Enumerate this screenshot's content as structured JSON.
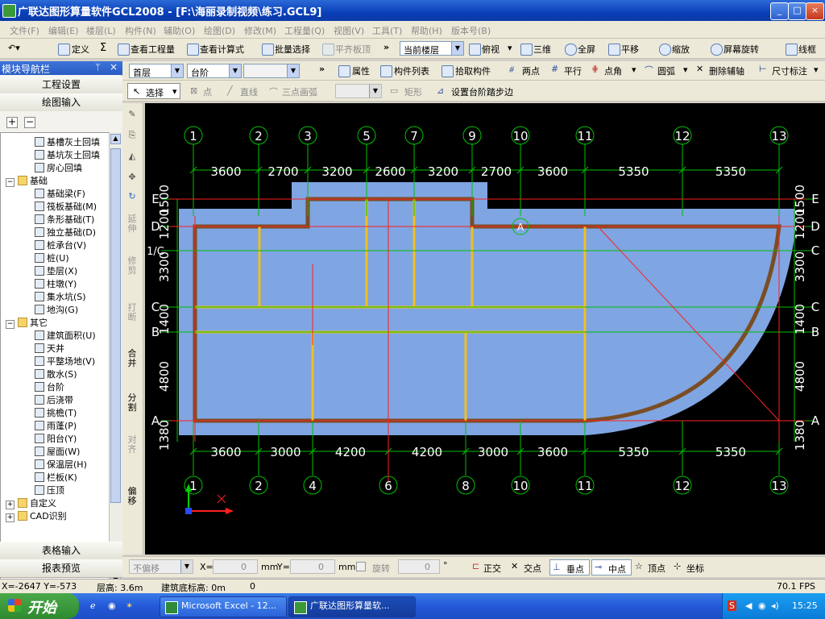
{
  "window": {
    "title": "广联达图形算量软件GCL2008 - [F:\\海丽录制视频\\练习.GCL9]",
    "btn_min": "_",
    "btn_max": "□",
    "btn_close": "×"
  },
  "menu": [
    "文件(F)",
    "编辑(E)",
    "楼层(L)",
    "构件(N)",
    "辅助(O)",
    "绘图(D)",
    "修改(M)",
    "工程量(Q)",
    "视图(V)",
    "工具(T)",
    "帮助(H)",
    "版本号(B)"
  ],
  "toolbar1": {
    "define": "定义",
    "sum": "Σ",
    "summary": "汇总计算",
    "view_project": "查看工程量",
    "view_formula": "查看计算式",
    "batch_select": "批量选择",
    "align_slab": "平齐板顶",
    "floor_combo": "当前楼层",
    "plan_view": "俯视",
    "three_d": "三维",
    "fullscreen": "全屏",
    "pan": "平移",
    "zoom": "缩放",
    "rotate": "屏幕旋转",
    "wireframe": "线框"
  },
  "toolbar2": {
    "floor": "首层",
    "component_type": "台阶",
    "properties": "属性",
    "comp_list": "构件列表",
    "pick": "拾取构件",
    "two_point": "两点",
    "parallel": "平行",
    "point_angle": "点角",
    "circle": "圆弧",
    "delete_aux": "删除辅轴",
    "dimension": "尺寸标注"
  },
  "toolbar3": {
    "select": "选择",
    "point": "点",
    "line": "直线",
    "arc3": "三点画弧",
    "rect": "矩形",
    "set_step": "设置台阶踏步边"
  },
  "left_panel": {
    "header": "模块导航栏",
    "pin": "ᛘ",
    "close": "×",
    "project_settings": "工程设置",
    "drawing_input": "绘图输入",
    "table_input": "表格输入",
    "report_preview": "报表预览",
    "tree": [
      {
        "label": "基槽灰土回填",
        "level": 2
      },
      {
        "label": "基坑灰土回填",
        "level": 2
      },
      {
        "label": "房心回填",
        "level": 2
      },
      {
        "label": "基础",
        "level": 1,
        "folder": true
      },
      {
        "label": "基础梁(F)",
        "level": 2
      },
      {
        "label": "筏板基础(M)",
        "level": 2
      },
      {
        "label": "条形基础(T)",
        "level": 2
      },
      {
        "label": "独立基础(D)",
        "level": 2
      },
      {
        "label": "桩承台(V)",
        "level": 2
      },
      {
        "label": "桩(U)",
        "level": 2
      },
      {
        "label": "垫层(X)",
        "level": 2
      },
      {
        "label": "柱墩(Y)",
        "level": 2
      },
      {
        "label": "集水坑(S)",
        "level": 2
      },
      {
        "label": "地沟(G)",
        "level": 2
      },
      {
        "label": "其它",
        "level": 1,
        "folder": true
      },
      {
        "label": "建筑面积(U)",
        "level": 2
      },
      {
        "label": "天井",
        "level": 2
      },
      {
        "label": "平整场地(V)",
        "level": 2
      },
      {
        "label": "散水(S)",
        "level": 2
      },
      {
        "label": "台阶",
        "level": 2
      },
      {
        "label": "后浇带",
        "level": 2
      },
      {
        "label": "挑檐(T)",
        "level": 2
      },
      {
        "label": "雨蓬(P)",
        "level": 2
      },
      {
        "label": "阳台(Y)",
        "level": 2
      },
      {
        "label": "屋面(W)",
        "level": 2
      },
      {
        "label": "保温层(H)",
        "level": 2
      },
      {
        "label": "栏板(K)",
        "level": 2
      },
      {
        "label": "压顶",
        "level": 2
      },
      {
        "label": "自定义",
        "level": 1,
        "folder": true
      },
      {
        "label": "CAD识别",
        "level": 1,
        "folder": true
      }
    ]
  },
  "vertical_toolbar": [
    "延伸",
    "修剪",
    "打断",
    "合并",
    "分割",
    "对齐",
    "偏移"
  ],
  "drawing": {
    "top_axes": [
      "1",
      "2",
      "3",
      "5",
      "7",
      "9",
      "10",
      "11",
      "12",
      "13"
    ],
    "top_dims": [
      "3600",
      "2700",
      "3200",
      "2600",
      "3200",
      "2700",
      "3600",
      "5350",
      "5350"
    ],
    "bottom_axes": [
      "1",
      "2",
      "4",
      "6",
      "8",
      "10",
      "11",
      "12",
      "13"
    ],
    "bottom_dims": [
      "3600",
      "3000",
      "4200",
      "4200",
      "3000",
      "3600",
      "5350",
      "5350"
    ],
    "left_axes": [
      "E",
      "D",
      "1/C",
      "C",
      "B",
      "A"
    ],
    "left_dims": [
      "1500",
      "1200",
      "3300",
      "1400",
      "4800",
      "1380"
    ],
    "right_axes": [
      "E",
      "D",
      "C",
      "C",
      "B",
      "A"
    ],
    "right_dims": [
      "1500",
      "1200",
      "3300",
      "1400",
      "4800",
      "1380"
    ],
    "point_marker": "A",
    "colors": {
      "background": "#000000",
      "axis": "#00c000",
      "red_line": "#ff2020",
      "step_fill": "#7fa5e2",
      "wall": "#7a4d24",
      "beam": "#f0c020",
      "dim_text": "#ffffff"
    }
  },
  "bottom_toolbar": {
    "mode": "不偏移",
    "x_label": "X=",
    "x_val": "0",
    "x_unit": "mm",
    "y_label": "Y=",
    "y_val": "0",
    "y_unit": "mm",
    "rotate": "旋转",
    "rot_val": "0",
    "deg": "°",
    "ortho": "正交",
    "intersect": "交点",
    "perpendicular": "垂点",
    "midpoint": "中点",
    "vertex": "顶点",
    "coordinate": "坐标"
  },
  "status": {
    "coords": "X=-2647 Y=-573",
    "floor_height": "层高: 3.6m",
    "base_height": "建筑底标高: 0m",
    "zero": "0",
    "fps": "70.1 FPS"
  },
  "taskbar": {
    "start": "开始",
    "tasks": [
      "Microsoft Excel - 12...",
      "广联达图形算量软..."
    ],
    "clock": "15:25"
  }
}
